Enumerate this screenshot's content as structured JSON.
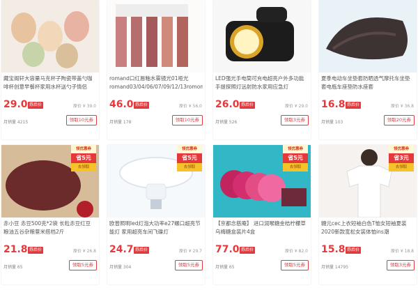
{
  "products": [
    {
      "title": "藏宝阁轩大容量马克杯子陶瓷带盖勺咖啡杯创意早餐杯家用水杯送勺子情侣",
      "price": "29.0",
      "coupon_tag": "券后价",
      "original": "原价 ¥ 39.0",
      "sales": "月销量 4215",
      "redeem": "领取10元券",
      "thumb_icon": "mugs-icon",
      "badge": null
    },
    {
      "title": "romand口红唇釉水雾镜光01哑光 romand03/04/06/07/09/12/13romon",
      "price": "46.0",
      "coupon_tag": "券后价",
      "original": "原价 ¥ 56.0",
      "sales": "月销量 178",
      "redeem": "领取10元券",
      "thumb_icon": "lipgloss-icon",
      "badge": null
    },
    {
      "title": "LED强光手电筒可充电超亮户外多功能手提探照灯远射防水家用应急灯",
      "price": "26.0",
      "coupon_tag": "券后价",
      "original": "原价 ¥ 29.0",
      "sales": "月销量 526",
      "redeem": "领取3元券",
      "thumb_icon": "flashlight-icon",
      "badge": null
    },
    {
      "title": "夏季电动车坐垫套防晒透气摩托车坐垫套电瓶车座垫防水座套",
      "price": "16.8",
      "coupon_tag": "券后价",
      "original": "原价 ¥ 36.8",
      "sales": "月销量 103",
      "redeem": "领取20元券",
      "thumb_icon": "seat-cover-icon",
      "badge": null
    },
    {
      "title": "赤小豆 赤豆500克*2袋 长粒赤豆红豆 粮油五谷杂粮薏米搭档2斤",
      "price": "21.8",
      "coupon_tag": "券后价",
      "original": "原价 ¥ 26.8",
      "sales": "月销量 65",
      "redeem": "领取5元券",
      "thumb_icon": "beans-icon",
      "badge": {
        "top": "领优惠券",
        "mid": "省5元",
        "bot": "去领取"
      }
    },
    {
      "title": "欧普照明led灯泡大功率e27螺口超亮节能灯 家用超亮车间飞碟灯",
      "price": "24.7",
      "coupon_tag": "券后价",
      "original": "原价 ¥ 29.7",
      "sales": "月销量 304",
      "redeem": "领取5元券",
      "thumb_icon": "bulb-icon",
      "badge": {
        "top": "领优惠券",
        "mid": "省5元",
        "bot": "去领取"
      }
    },
    {
      "title": "【京都念慈庵】 进口润喉糖金桔柠檬草 乌梅糖盒装片4盒",
      "price": "77.0",
      "coupon_tag": "券后价",
      "original": "原价 ¥ 82.0",
      "sales": "月销量 65",
      "redeem": "领取5元券",
      "thumb_icon": "candy-icon",
      "badge": {
        "top": "领优惠券",
        "mid": "省5元",
        "bot": "去领取"
      }
    },
    {
      "title": "糖元cec上衣短袖白色T恤女短袖夏装2020新款宽松女装体恤ins潮",
      "price": "15.8",
      "coupon_tag": "券后价",
      "original": "原价 ¥ 18.8",
      "sales": "月销量 14795",
      "redeem": "领取3元券",
      "thumb_icon": "tshirt-icon",
      "badge": {
        "top": "领优惠券",
        "mid": "省3元",
        "bot": "去领取"
      }
    }
  ]
}
